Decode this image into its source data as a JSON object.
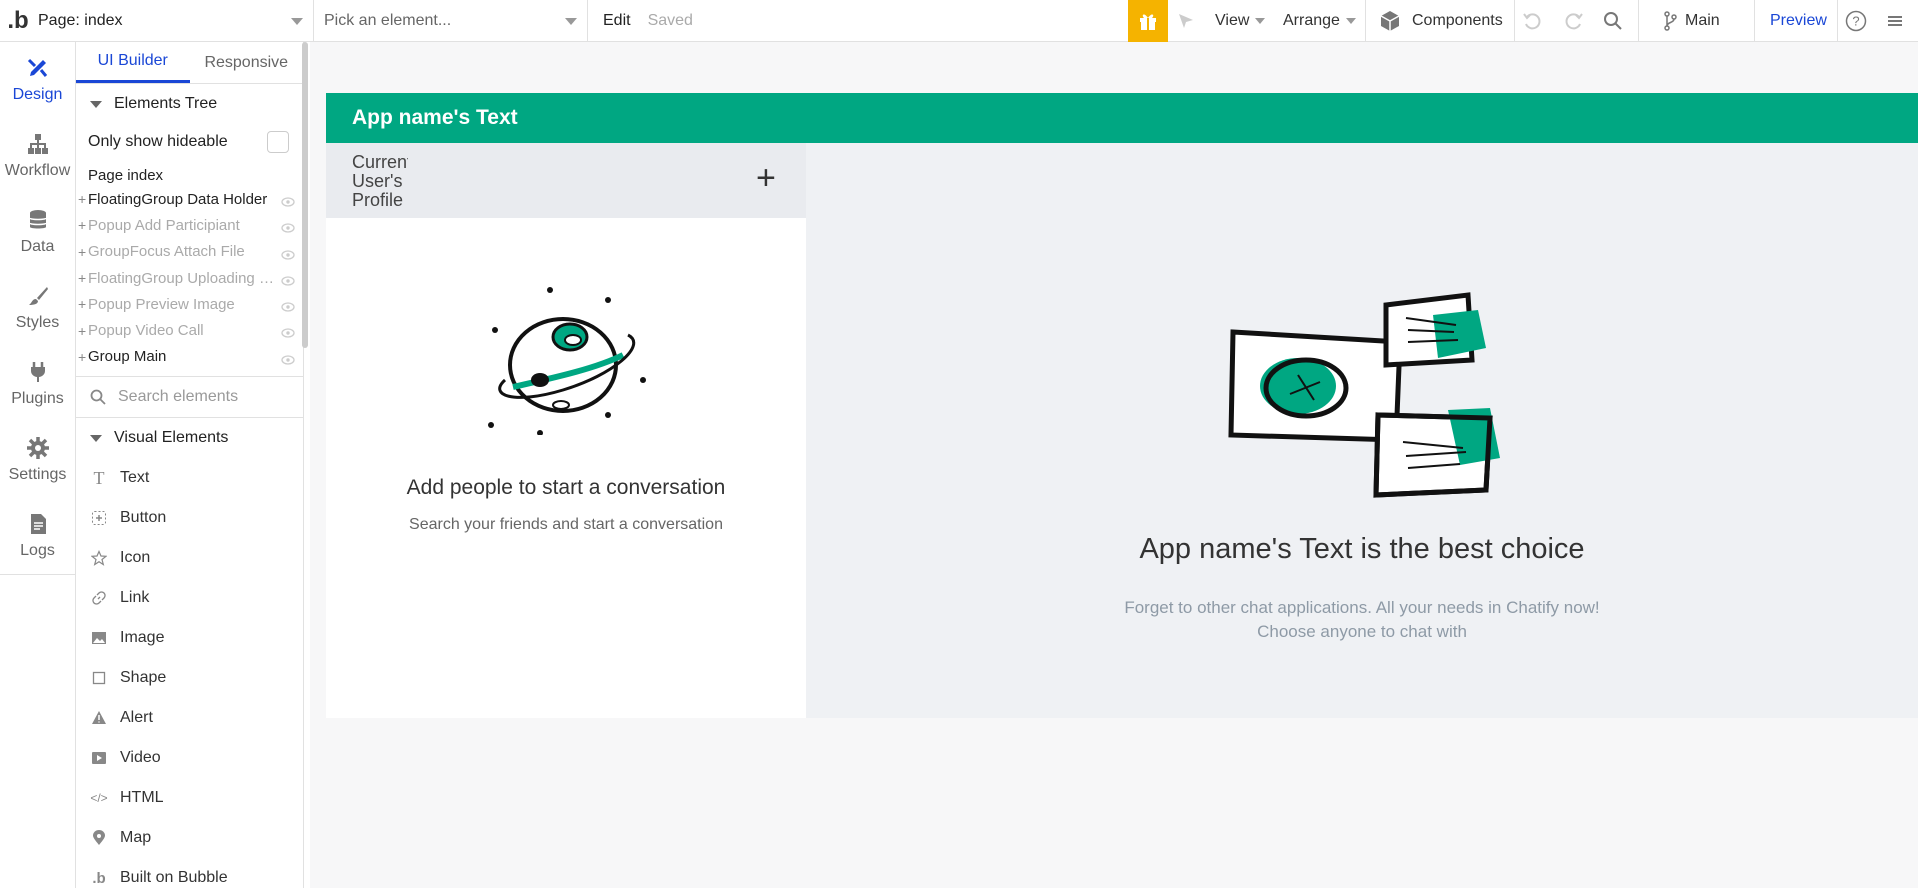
{
  "topbar": {
    "page_select": "Page: index",
    "element_select": "Pick an element...",
    "edit": "Edit",
    "saved": "Saved",
    "view": "View",
    "arrange": "Arrange",
    "components": "Components",
    "branch": "Main",
    "preview": "Preview"
  },
  "rail": {
    "items": [
      {
        "label": "Design",
        "icon": "design-icon"
      },
      {
        "label": "Workflow",
        "icon": "workflow-icon"
      },
      {
        "label": "Data",
        "icon": "database-icon"
      },
      {
        "label": "Styles",
        "icon": "brush-icon"
      },
      {
        "label": "Plugins",
        "icon": "plug-icon"
      },
      {
        "label": "Settings",
        "icon": "gear-icon"
      },
      {
        "label": "Logs",
        "icon": "document-icon"
      }
    ]
  },
  "panel": {
    "tabs": [
      "UI Builder",
      "Responsive"
    ],
    "elements_tree": "Elements Tree",
    "only_show_hideable": "Only show hideable",
    "page_node": "Page index",
    "tree": [
      {
        "label": "FloatingGroup Data Holder",
        "dim": false
      },
      {
        "label": "Popup Add Participiant",
        "dim": true
      },
      {
        "label": "GroupFocus Attach File",
        "dim": true
      },
      {
        "label": "FloatingGroup Uploading Fi...",
        "dim": true
      },
      {
        "label": "Popup Preview Image",
        "dim": true
      },
      {
        "label": "Popup Video Call",
        "dim": true
      },
      {
        "label": "Group Main",
        "dim": false
      }
    ],
    "search_placeholder": "Search elements",
    "visual_elements": "Visual Elements",
    "visual_items": [
      {
        "label": "Text",
        "icon": "text-icon"
      },
      {
        "label": "Button",
        "icon": "button-icon"
      },
      {
        "label": "Icon",
        "icon": "star-icon"
      },
      {
        "label": "Link",
        "icon": "link-icon"
      },
      {
        "label": "Image",
        "icon": "image-icon"
      },
      {
        "label": "Shape",
        "icon": "shape-icon"
      },
      {
        "label": "Alert",
        "icon": "alert-icon"
      },
      {
        "label": "Video",
        "icon": "video-icon"
      },
      {
        "label": "HTML",
        "icon": "code-icon"
      },
      {
        "label": "Map",
        "icon": "map-pin-icon"
      },
      {
        "label": "Built on Bubble",
        "icon": "bubble-logo-icon"
      }
    ]
  },
  "canvas": {
    "header_title": "App name's Text",
    "profile_text": "Current User's Profile",
    "empty_title": "Add people to start a conversation",
    "empty_sub": "Search your friends and start a conversation",
    "right_title": "App name's Text is the best choice",
    "right_sub_line1": "Forget to other chat applications. All your needs in Chatify now!",
    "right_sub_line2": "Choose anyone to chat with"
  },
  "colors": {
    "brand_green": "#00a782",
    "accent_blue": "#1a47d6",
    "gift_yellow": "#f5b300"
  }
}
